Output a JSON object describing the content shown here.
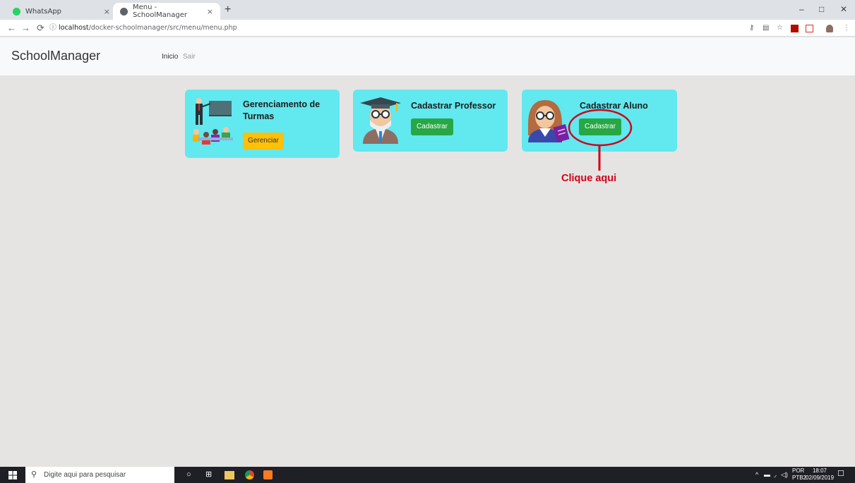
{
  "browser": {
    "tabs": [
      {
        "title": "WhatsApp",
        "favicon_color": "#25d366"
      },
      {
        "title": "Menu - SchoolManager",
        "favicon_color": "#5f6368"
      }
    ],
    "new_tab_symbol": "+",
    "close_symbol": "×",
    "window_controls": {
      "minimize": "–",
      "restore": "□",
      "close": "✕"
    },
    "url_host": "localhost",
    "url_path": "/docker-schoolmanager/src/menu/menu.php"
  },
  "navbar": {
    "brand": "SchoolManager",
    "links": [
      {
        "label": "Inicio"
      },
      {
        "label": "Sair"
      }
    ]
  },
  "cards": [
    {
      "title": "Gerenciamento de Turmas",
      "title_line1": "Gerenciamento de",
      "title_line2": "Turmas",
      "button": "Gerenciar",
      "button_color": "#ffc107",
      "icon": "classroom-icon"
    },
    {
      "title": "Cadastrar Professor",
      "button": "Cadastrar",
      "button_color": "#28a745",
      "icon": "professor-icon"
    },
    {
      "title": "Cadastrar Aluno",
      "button": "Cadastrar",
      "button_color": "#28a745",
      "icon": "student-icon"
    }
  ],
  "annotation": {
    "label": "Clique aqui",
    "color": "#d0021b"
  },
  "taskbar": {
    "search_placeholder": "Digite aqui para pesquisar",
    "lang_top": "POR",
    "lang_bottom": "PTB2",
    "time": "18:07",
    "date": "02/09/2019"
  },
  "colors": {
    "card_bg": "#62e8ef",
    "page_bg": "#e6e4e2",
    "navbar_bg": "#f8f9fa"
  }
}
